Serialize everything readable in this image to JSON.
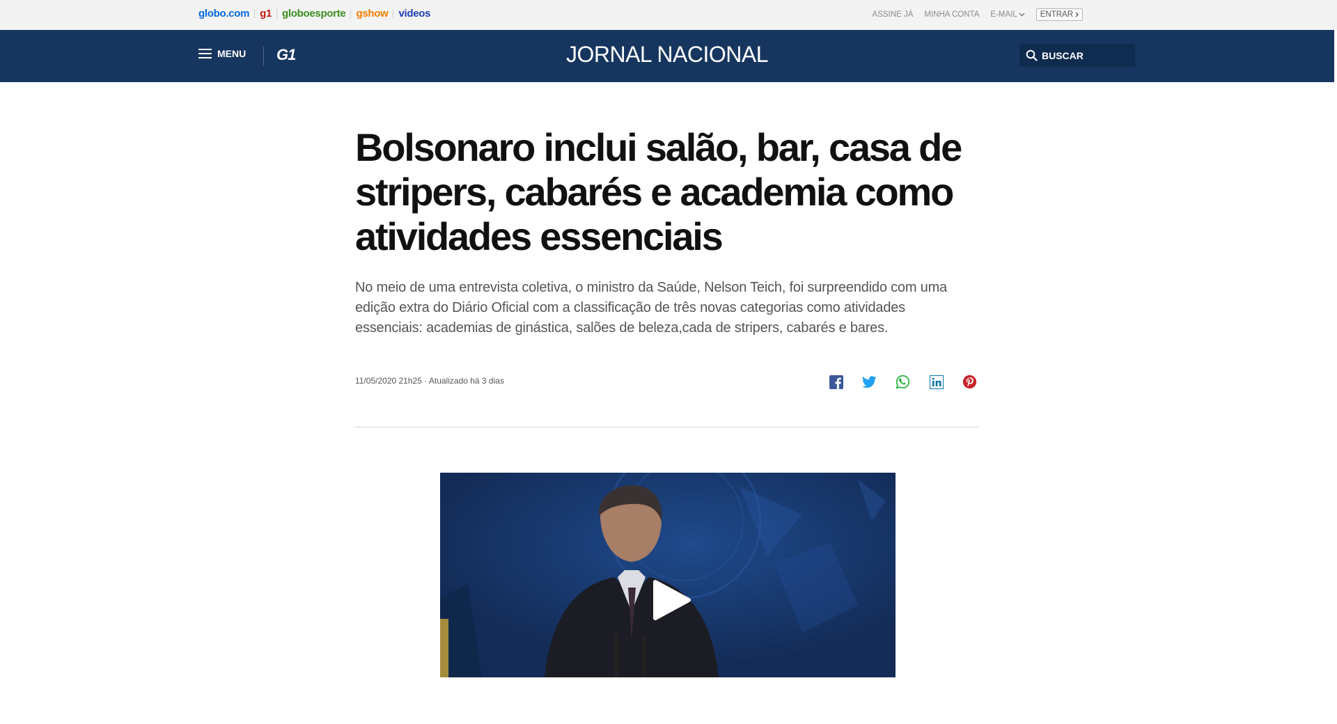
{
  "topbar": {
    "links": {
      "globo": "globo.com",
      "g1": "g1",
      "globoesporte": "globoesporte",
      "gshow": "gshow",
      "videos": "videos"
    },
    "account": {
      "assine": "ASSINE JÁ",
      "minha_conta": "MINHA CONTA",
      "email": "E-MAIL",
      "entrar": "ENTRAR"
    }
  },
  "header": {
    "menu_label": "MENU",
    "logo": "G1",
    "title": "JORNAL NACIONAL",
    "search_label": "BUSCAR"
  },
  "article": {
    "headline": "Bolsonaro inclui salão, bar, casa de stripers, cabarés e academia como atividades essenciais",
    "subtitle": "No meio de uma entrevista coletiva, o ministro da Saúde, Nelson Teich, foi surpreendido com uma edição extra do Diário Oficial com a classificação de três novas categorias como atividades essenciais: academias de ginástica, salões de beleza,cada de stripers, cabarés e bares.",
    "meta": "11/05/2020 21h25 · Atualizado há 3 dias"
  },
  "share": {
    "icons": [
      "facebook-icon",
      "twitter-icon",
      "whatsapp-icon",
      "linkedin-icon",
      "pinterest-icon"
    ]
  },
  "colors": {
    "header_bg": "#16365f",
    "facebook": "#3b5998",
    "twitter": "#1da1f2",
    "whatsapp": "#25b43b",
    "linkedin": "#0e76a8",
    "pinterest": "#c8232c"
  }
}
